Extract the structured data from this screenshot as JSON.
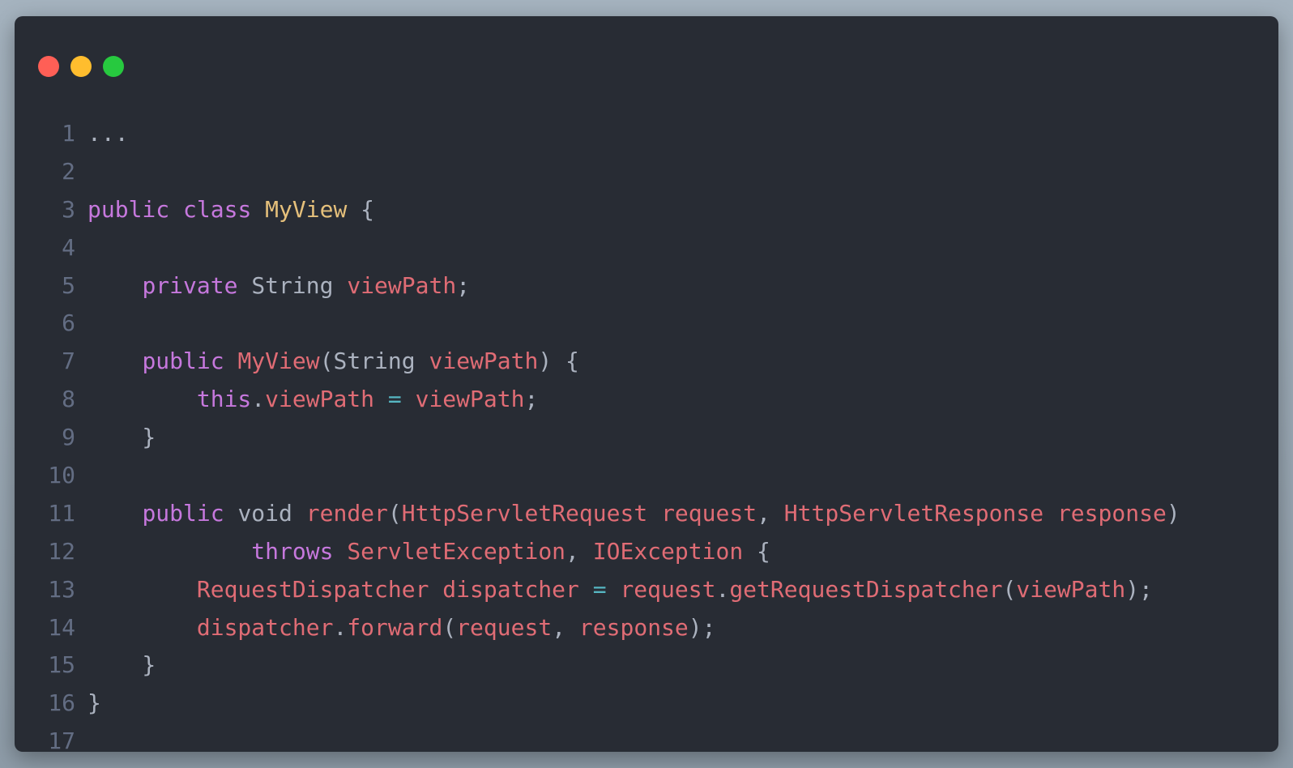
{
  "window": {
    "controls": [
      "close-dot",
      "minimize-dot",
      "maximize-dot"
    ],
    "colors": {
      "background": "#282c34",
      "close": "#ff5f56",
      "minimize": "#ffbd2e",
      "maximize": "#27c93f",
      "keyword": "#c678dd",
      "class_name": "#e5c07b",
      "variable": "#e06c75",
      "operator": "#56b6c2",
      "plain": "#abb2bf",
      "line_number": "#636d83"
    }
  },
  "code": {
    "language": "java",
    "lines": [
      {
        "n": "1",
        "tokens": [
          {
            "t": "...",
            "c": "punc"
          }
        ]
      },
      {
        "n": "2",
        "tokens": []
      },
      {
        "n": "3",
        "tokens": [
          {
            "t": "public",
            "c": "kw"
          },
          {
            "t": " ",
            "c": "punc"
          },
          {
            "t": "class",
            "c": "kw"
          },
          {
            "t": " ",
            "c": "punc"
          },
          {
            "t": "MyView",
            "c": "cls"
          },
          {
            "t": " {",
            "c": "punc"
          }
        ]
      },
      {
        "n": "4",
        "tokens": []
      },
      {
        "n": "5",
        "tokens": [
          {
            "t": "    ",
            "c": "punc"
          },
          {
            "t": "private",
            "c": "kw"
          },
          {
            "t": " ",
            "c": "punc"
          },
          {
            "t": "String",
            "c": "type"
          },
          {
            "t": " ",
            "c": "punc"
          },
          {
            "t": "viewPath",
            "c": "var"
          },
          {
            "t": ";",
            "c": "punc"
          }
        ]
      },
      {
        "n": "6",
        "tokens": []
      },
      {
        "n": "7",
        "tokens": [
          {
            "t": "    ",
            "c": "punc"
          },
          {
            "t": "public",
            "c": "kw"
          },
          {
            "t": " ",
            "c": "punc"
          },
          {
            "t": "MyView",
            "c": "var"
          },
          {
            "t": "(",
            "c": "punc"
          },
          {
            "t": "String",
            "c": "type"
          },
          {
            "t": " ",
            "c": "punc"
          },
          {
            "t": "viewPath",
            "c": "var"
          },
          {
            "t": ") {",
            "c": "punc"
          }
        ]
      },
      {
        "n": "8",
        "tokens": [
          {
            "t": "        ",
            "c": "punc"
          },
          {
            "t": "this",
            "c": "kw"
          },
          {
            "t": ".",
            "c": "punc"
          },
          {
            "t": "viewPath",
            "c": "var"
          },
          {
            "t": " ",
            "c": "punc"
          },
          {
            "t": "=",
            "c": "op"
          },
          {
            "t": " ",
            "c": "punc"
          },
          {
            "t": "viewPath",
            "c": "var"
          },
          {
            "t": ";",
            "c": "punc"
          }
        ]
      },
      {
        "n": "9",
        "tokens": [
          {
            "t": "    }",
            "c": "punc"
          }
        ]
      },
      {
        "n": "10",
        "tokens": []
      },
      {
        "n": "11",
        "tokens": [
          {
            "t": "    ",
            "c": "punc"
          },
          {
            "t": "public",
            "c": "kw"
          },
          {
            "t": " ",
            "c": "punc"
          },
          {
            "t": "void",
            "c": "type"
          },
          {
            "t": " ",
            "c": "punc"
          },
          {
            "t": "render",
            "c": "var"
          },
          {
            "t": "(",
            "c": "punc"
          },
          {
            "t": "HttpServletRequest",
            "c": "var"
          },
          {
            "t": " ",
            "c": "punc"
          },
          {
            "t": "request",
            "c": "var"
          },
          {
            "t": ", ",
            "c": "punc"
          },
          {
            "t": "HttpServletResponse",
            "c": "var"
          },
          {
            "t": " ",
            "c": "punc"
          },
          {
            "t": "response",
            "c": "var"
          },
          {
            "t": ")",
            "c": "punc"
          }
        ]
      },
      {
        "n": "12",
        "tokens": [
          {
            "t": "            ",
            "c": "punc"
          },
          {
            "t": "throws",
            "c": "kw"
          },
          {
            "t": " ",
            "c": "punc"
          },
          {
            "t": "ServletException",
            "c": "var"
          },
          {
            "t": ", ",
            "c": "punc"
          },
          {
            "t": "IOException",
            "c": "var"
          },
          {
            "t": " {",
            "c": "punc"
          }
        ]
      },
      {
        "n": "13",
        "tokens": [
          {
            "t": "        ",
            "c": "punc"
          },
          {
            "t": "RequestDispatcher",
            "c": "var"
          },
          {
            "t": " ",
            "c": "punc"
          },
          {
            "t": "dispatcher",
            "c": "var"
          },
          {
            "t": " ",
            "c": "punc"
          },
          {
            "t": "=",
            "c": "op"
          },
          {
            "t": " ",
            "c": "punc"
          },
          {
            "t": "request",
            "c": "var"
          },
          {
            "t": ".",
            "c": "punc"
          },
          {
            "t": "getRequestDispatcher",
            "c": "var"
          },
          {
            "t": "(",
            "c": "punc"
          },
          {
            "t": "viewPath",
            "c": "var"
          },
          {
            "t": ");",
            "c": "punc"
          }
        ]
      },
      {
        "n": "14",
        "tokens": [
          {
            "t": "        ",
            "c": "punc"
          },
          {
            "t": "dispatcher",
            "c": "var"
          },
          {
            "t": ".",
            "c": "punc"
          },
          {
            "t": "forward",
            "c": "var"
          },
          {
            "t": "(",
            "c": "punc"
          },
          {
            "t": "request",
            "c": "var"
          },
          {
            "t": ", ",
            "c": "punc"
          },
          {
            "t": "response",
            "c": "var"
          },
          {
            "t": ");",
            "c": "punc"
          }
        ]
      },
      {
        "n": "15",
        "tokens": [
          {
            "t": "    }",
            "c": "punc"
          }
        ]
      },
      {
        "n": "16",
        "tokens": [
          {
            "t": "}",
            "c": "punc"
          }
        ]
      },
      {
        "n": "17",
        "tokens": []
      }
    ]
  }
}
